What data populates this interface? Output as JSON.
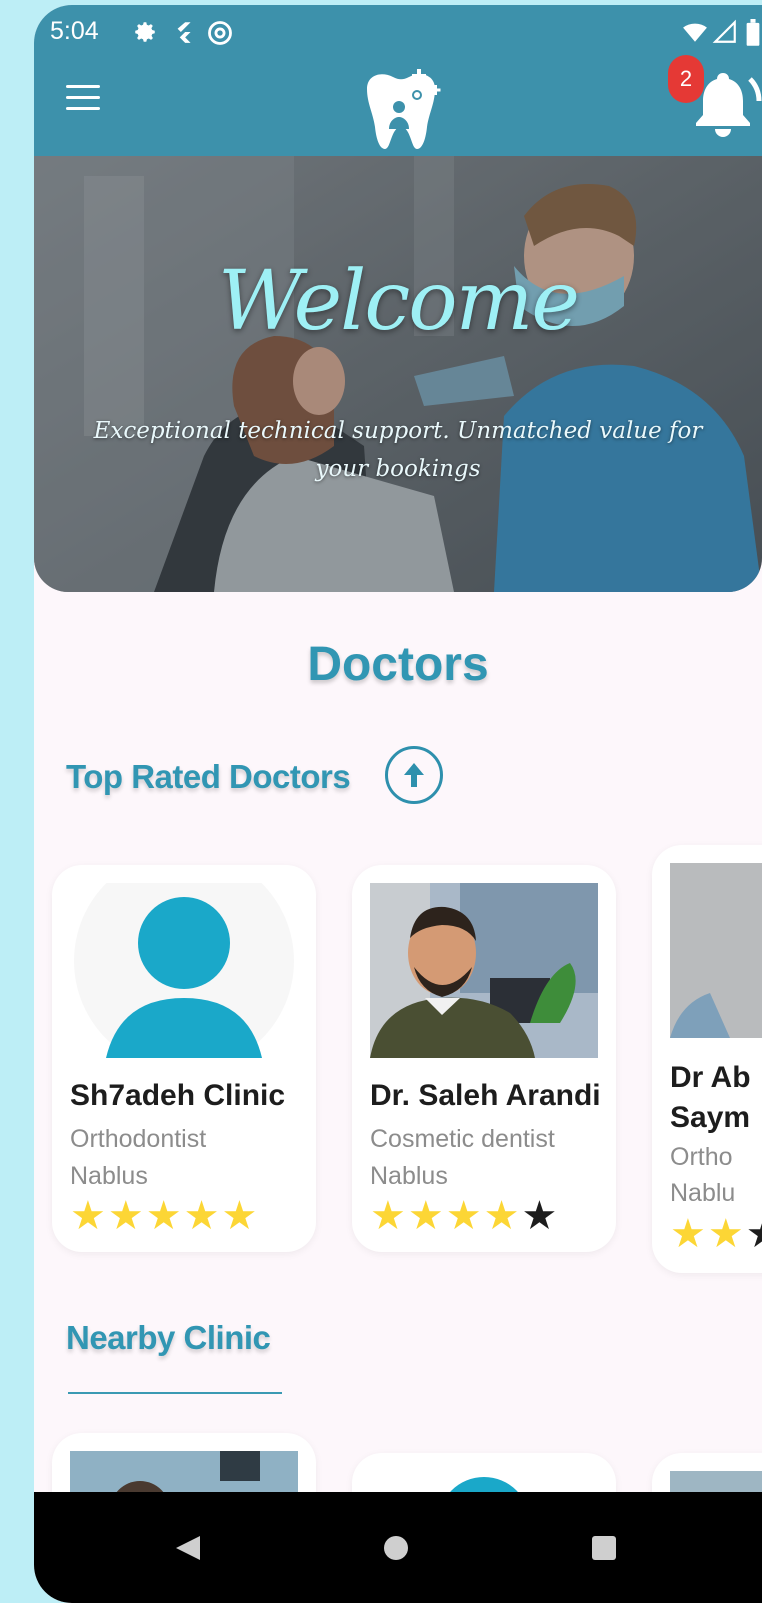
{
  "status_bar": {
    "time": "5:04"
  },
  "header": {
    "notification_count": "2"
  },
  "hero": {
    "title": "Welcome",
    "subtitle": "Exceptional technical support. Unmatched value for your bookings"
  },
  "sections": {
    "doctors_title": "Doctors",
    "top_rated_title": "Top Rated Doctors",
    "nearby_title": "Nearby Clinic"
  },
  "doctors": [
    {
      "name": "Sh7adeh Clinic",
      "specialty": "Orthodontist",
      "city": "Nablus",
      "rating": 5
    },
    {
      "name": "Dr. Saleh Arandi",
      "specialty": "Cosmetic dentist",
      "city": "Nablus",
      "rating": 4
    },
    {
      "name_line1": "Dr Ab",
      "name_line2": "Saym",
      "specialty": "Ortho",
      "city": "Nablu",
      "rating": 2
    }
  ],
  "colors": {
    "primary": "#3d91ab",
    "accent_text": "#3196b3",
    "star": "#fcd635",
    "badge": "#e53935"
  }
}
